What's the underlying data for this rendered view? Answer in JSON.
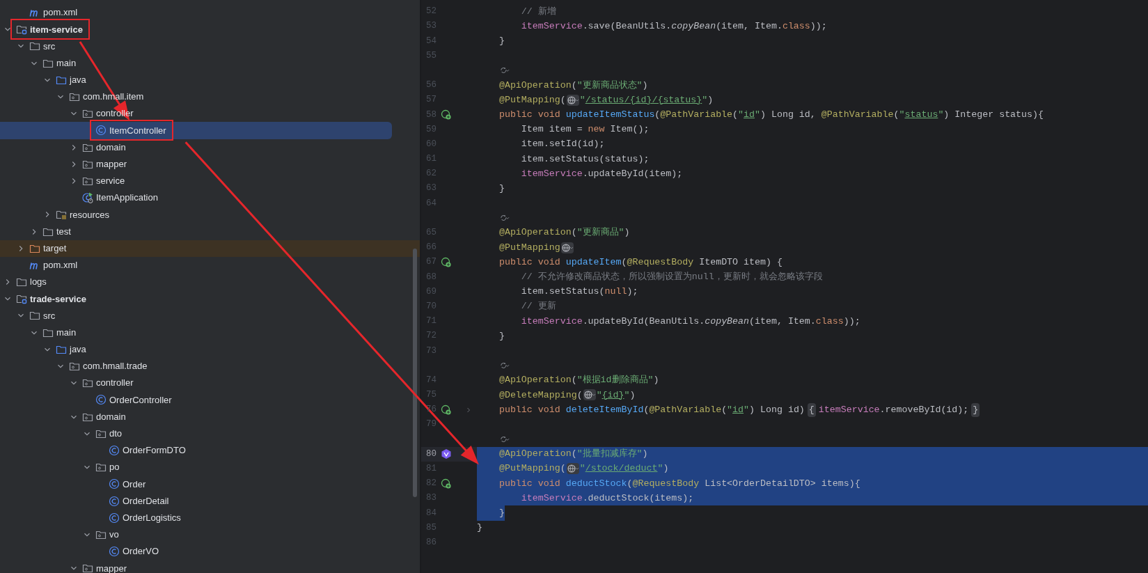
{
  "project_tree": {
    "continued_items": [
      {
        "label": "pom.xml",
        "kind": "maven",
        "selected": false,
        "framed": false,
        "excluded": false
      }
    ],
    "items": [
      {
        "label": "item-service",
        "kind": "module",
        "expanded": true,
        "selected": false,
        "framed": true,
        "excluded": false,
        "children": [
          {
            "label": "src",
            "kind": "folder",
            "expanded": true,
            "selected": false,
            "framed": false,
            "excluded": false,
            "children": [
              {
                "label": "main",
                "kind": "folder",
                "expanded": true,
                "selected": false,
                "framed": false,
                "excluded": false,
                "children": [
                  {
                    "label": "java",
                    "kind": "source",
                    "expanded": true,
                    "selected": false,
                    "framed": false,
                    "excluded": false,
                    "children": [
                      {
                        "label": "com.hmall.item",
                        "kind": "package",
                        "expanded": true,
                        "selected": false,
                        "framed": false,
                        "excluded": false,
                        "children": [
                          {
                            "label": "controller",
                            "kind": "package",
                            "expanded": true,
                            "selected": false,
                            "framed": false,
                            "excluded": false,
                            "children": [
                              {
                                "label": "ItemController",
                                "kind": "class",
                                "selected": true,
                                "framed": true,
                                "excluded": false
                              }
                            ]
                          },
                          {
                            "label": "domain",
                            "kind": "package",
                            "expanded": false,
                            "selected": false,
                            "framed": false,
                            "excluded": false
                          },
                          {
                            "label": "mapper",
                            "kind": "package",
                            "expanded": false,
                            "selected": false,
                            "framed": false,
                            "excluded": false
                          },
                          {
                            "label": "service",
                            "kind": "package",
                            "expanded": false,
                            "selected": false,
                            "framed": false,
                            "excluded": false
                          },
                          {
                            "label": "ItemApplication",
                            "kind": "app",
                            "selected": false,
                            "framed": false,
                            "excluded": false
                          }
                        ]
                      }
                    ]
                  },
                  {
                    "label": "resources",
                    "kind": "resources",
                    "expanded": false,
                    "selected": false,
                    "framed": false,
                    "excluded": false
                  }
                ]
              },
              {
                "label": "test",
                "kind": "folder",
                "expanded": false,
                "selected": false,
                "framed": false,
                "excluded": false
              }
            ]
          },
          {
            "label": "target",
            "kind": "folder",
            "expanded": false,
            "selected": false,
            "framed": false,
            "excluded": true
          },
          {
            "label": "pom.xml",
            "kind": "maven",
            "selected": false,
            "framed": false,
            "excluded": false
          }
        ]
      },
      {
        "label": "logs",
        "kind": "folder",
        "expanded": false,
        "selected": false,
        "framed": false,
        "excluded": false
      },
      {
        "label": "trade-service",
        "kind": "module",
        "expanded": true,
        "selected": false,
        "framed": false,
        "excluded": false,
        "children": [
          {
            "label": "src",
            "kind": "folder",
            "expanded": true,
            "selected": false,
            "framed": false,
            "excluded": false,
            "children": [
              {
                "label": "main",
                "kind": "folder",
                "expanded": true,
                "selected": false,
                "framed": false,
                "excluded": false,
                "children": [
                  {
                    "label": "java",
                    "kind": "source",
                    "expanded": true,
                    "selected": false,
                    "framed": false,
                    "excluded": false,
                    "children": [
                      {
                        "label": "com.hmall.trade",
                        "kind": "package",
                        "expanded": true,
                        "selected": false,
                        "framed": false,
                        "excluded": false,
                        "children": [
                          {
                            "label": "controller",
                            "kind": "package",
                            "expanded": true,
                            "selected": false,
                            "framed": false,
                            "excluded": false,
                            "children": [
                              {
                                "label": "OrderController",
                                "kind": "class",
                                "selected": false,
                                "framed": false,
                                "excluded": false
                              }
                            ]
                          },
                          {
                            "label": "domain",
                            "kind": "package",
                            "expanded": true,
                            "selected": false,
                            "framed": false,
                            "excluded": false,
                            "children": [
                              {
                                "label": "dto",
                                "kind": "package",
                                "expanded": true,
                                "selected": false,
                                "framed": false,
                                "excluded": false,
                                "children": [
                                  {
                                    "label": "OrderFormDTO",
                                    "kind": "class",
                                    "selected": false,
                                    "framed": false,
                                    "excluded": false
                                  }
                                ]
                              },
                              {
                                "label": "po",
                                "kind": "package",
                                "expanded": true,
                                "selected": false,
                                "framed": false,
                                "excluded": false,
                                "children": [
                                  {
                                    "label": "Order",
                                    "kind": "class",
                                    "selected": false,
                                    "framed": false,
                                    "excluded": false
                                  },
                                  {
                                    "label": "OrderDetail",
                                    "kind": "class",
                                    "selected": false,
                                    "framed": false,
                                    "excluded": false
                                  },
                                  {
                                    "label": "OrderLogistics",
                                    "kind": "class",
                                    "selected": false,
                                    "framed": false,
                                    "excluded": false
                                  }
                                ]
                              },
                              {
                                "label": "vo",
                                "kind": "package",
                                "expanded": true,
                                "selected": false,
                                "framed": false,
                                "excluded": false,
                                "children": [
                                  {
                                    "label": "OrderVO",
                                    "kind": "class",
                                    "selected": false,
                                    "framed": false,
                                    "excluded": false
                                  }
                                ]
                              }
                            ]
                          },
                          {
                            "label": "mapper",
                            "kind": "package",
                            "expanded": true,
                            "selected": false,
                            "framed": false,
                            "excluded": false
                          }
                        ]
                      }
                    ]
                  }
                ]
              }
            ]
          }
        ]
      }
    ]
  },
  "editor": {
    "lines": [
      {
        "kind": "code",
        "number": "52",
        "current": false,
        "selected": false,
        "segments": [
          {
            "kind": "comment",
            "text": "        // 新增"
          }
        ]
      },
      {
        "kind": "code",
        "number": "53",
        "current": false,
        "selected": false,
        "segments": [
          {
            "kind": "field",
            "text": "        itemService"
          },
          {
            "kind": "plain",
            "text": ".save(BeanUtils."
          },
          {
            "kind": "static",
            "text": "copyBean"
          },
          {
            "kind": "plain",
            "text": "(item, Item."
          },
          {
            "kind": "keyword",
            "text": "class"
          },
          {
            "kind": "plain",
            "text": "));"
          }
        ]
      },
      {
        "kind": "code",
        "number": "54",
        "current": false,
        "selected": false,
        "segments": [
          {
            "kind": "plain",
            "text": "    }"
          }
        ]
      },
      {
        "kind": "code",
        "number": "55",
        "current": false,
        "selected": false
      },
      {
        "kind": "hint"
      },
      {
        "kind": "code",
        "number": "56",
        "current": false,
        "selected": false,
        "segments": [
          {
            "kind": "annotation",
            "text": "    @ApiOperation"
          },
          {
            "kind": "plain",
            "text": "("
          },
          {
            "kind": "string",
            "text": "\"更新商品状态\""
          },
          {
            "kind": "plain",
            "text": ")"
          }
        ]
      },
      {
        "kind": "code",
        "number": "57",
        "current": false,
        "selected": false,
        "segments": [
          {
            "kind": "annotation",
            "text": "    @PutMapping"
          },
          {
            "kind": "plain",
            "text": "("
          },
          {
            "kind": "globe"
          },
          {
            "kind": "string",
            "text": "\""
          },
          {
            "kind": "link",
            "text": "/status/{id}/{status}"
          },
          {
            "kind": "string",
            "text": "\""
          },
          {
            "kind": "plain",
            "text": ")"
          }
        ]
      },
      {
        "kind": "code",
        "number": "58",
        "current": false,
        "selected": false,
        "gutter_icon": {
          "kind": "endpoint"
        },
        "segments": [
          {
            "kind": "keyword",
            "text": "    public void "
          },
          {
            "kind": "method",
            "text": "updateItemStatus"
          },
          {
            "kind": "plain",
            "text": "("
          },
          {
            "kind": "annotation",
            "text": "@PathVariable"
          },
          {
            "kind": "plain",
            "text": "("
          },
          {
            "kind": "string",
            "text": "\""
          },
          {
            "kind": "link",
            "text": "id"
          },
          {
            "kind": "string",
            "text": "\""
          },
          {
            "kind": "plain",
            "text": ") Long id, "
          },
          {
            "kind": "annotation",
            "text": "@PathVariable"
          },
          {
            "kind": "plain",
            "text": "("
          },
          {
            "kind": "string",
            "text": "\""
          },
          {
            "kind": "link",
            "text": "status"
          },
          {
            "kind": "string",
            "text": "\""
          },
          {
            "kind": "plain",
            "text": ") Integer status){"
          }
        ]
      },
      {
        "kind": "code",
        "number": "59",
        "current": false,
        "selected": false,
        "segments": [
          {
            "kind": "plain",
            "text": "        Item item = "
          },
          {
            "kind": "keyword",
            "text": "new"
          },
          {
            "kind": "plain",
            "text": " Item();"
          }
        ]
      },
      {
        "kind": "code",
        "number": "60",
        "current": false,
        "selected": false,
        "segments": [
          {
            "kind": "plain",
            "text": "        item.setId(id);"
          }
        ]
      },
      {
        "kind": "code",
        "number": "61",
        "current": false,
        "selected": false,
        "segments": [
          {
            "kind": "plain",
            "text": "        item.setStatus(status);"
          }
        ]
      },
      {
        "kind": "code",
        "number": "62",
        "current": false,
        "selected": false,
        "segments": [
          {
            "kind": "field",
            "text": "        itemService"
          },
          {
            "kind": "plain",
            "text": ".updateById(item);"
          }
        ]
      },
      {
        "kind": "code",
        "number": "63",
        "current": false,
        "selected": false,
        "segments": [
          {
            "kind": "plain",
            "text": "    }"
          }
        ]
      },
      {
        "kind": "code",
        "number": "64",
        "current": false,
        "selected": false
      },
      {
        "kind": "hint"
      },
      {
        "kind": "code",
        "number": "65",
        "current": false,
        "selected": false,
        "segments": [
          {
            "kind": "annotation",
            "text": "    @ApiOperation"
          },
          {
            "kind": "plain",
            "text": "("
          },
          {
            "kind": "string",
            "text": "\"更新商品\""
          },
          {
            "kind": "plain",
            "text": ")"
          }
        ]
      },
      {
        "kind": "code",
        "number": "66",
        "current": false,
        "selected": false,
        "segments": [
          {
            "kind": "annotation",
            "text": "    @PutMapping"
          },
          {
            "kind": "globe"
          }
        ]
      },
      {
        "kind": "code",
        "number": "67",
        "current": false,
        "selected": false,
        "gutter_icon": {
          "kind": "endpoint"
        },
        "segments": [
          {
            "kind": "keyword",
            "text": "    public void "
          },
          {
            "kind": "method",
            "text": "updateItem"
          },
          {
            "kind": "plain",
            "text": "("
          },
          {
            "kind": "annotation",
            "text": "@RequestBody"
          },
          {
            "kind": "plain",
            "text": " ItemDTO item) {"
          }
        ]
      },
      {
        "kind": "code",
        "number": "68",
        "current": false,
        "selected": false,
        "segments": [
          {
            "kind": "comment",
            "text": "        // 不允许修改商品状态，所以强制设置为null，更新时，就会忽略该字段"
          }
        ]
      },
      {
        "kind": "code",
        "number": "69",
        "current": false,
        "selected": false,
        "segments": [
          {
            "kind": "plain",
            "text": "        item.setStatus("
          },
          {
            "kind": "keyword",
            "text": "null"
          },
          {
            "kind": "plain",
            "text": ");"
          }
        ]
      },
      {
        "kind": "code",
        "number": "70",
        "current": false,
        "selected": false,
        "segments": [
          {
            "kind": "comment",
            "text": "        // 更新"
          }
        ]
      },
      {
        "kind": "code",
        "number": "71",
        "current": false,
        "selected": false,
        "segments": [
          {
            "kind": "field",
            "text": "        itemService"
          },
          {
            "kind": "plain",
            "text": ".updateById(BeanUtils."
          },
          {
            "kind": "static",
            "text": "copyBean"
          },
          {
            "kind": "plain",
            "text": "(item, Item."
          },
          {
            "kind": "keyword",
            "text": "class"
          },
          {
            "kind": "plain",
            "text": "));"
          }
        ]
      },
      {
        "kind": "code",
        "number": "72",
        "current": false,
        "selected": false,
        "segments": [
          {
            "kind": "plain",
            "text": "    }"
          }
        ]
      },
      {
        "kind": "code",
        "number": "73",
        "current": false,
        "selected": false
      },
      {
        "kind": "hint"
      },
      {
        "kind": "code",
        "number": "74",
        "current": false,
        "selected": false,
        "segments": [
          {
            "kind": "annotation",
            "text": "    @ApiOperation"
          },
          {
            "kind": "plain",
            "text": "("
          },
          {
            "kind": "string",
            "text": "\"根据id删除商品\""
          },
          {
            "kind": "plain",
            "text": ")"
          }
        ]
      },
      {
        "kind": "code",
        "number": "75",
        "current": false,
        "selected": false,
        "segments": [
          {
            "kind": "annotation",
            "text": "    @DeleteMapping"
          },
          {
            "kind": "plain",
            "text": "("
          },
          {
            "kind": "globe"
          },
          {
            "kind": "string",
            "text": "\""
          },
          {
            "kind": "link",
            "text": "{id}"
          },
          {
            "kind": "string",
            "text": "\""
          },
          {
            "kind": "plain",
            "text": ")"
          }
        ]
      },
      {
        "kind": "code",
        "number": "76",
        "current": false,
        "selected": false,
        "gutter_icon": {
          "kind": "endpoint"
        },
        "segments": [
          {
            "kind": "keyword",
            "text": "    public void "
          },
          {
            "kind": "method",
            "text": "deleteItemById"
          },
          {
            "kind": "plain",
            "text": "("
          },
          {
            "kind": "annotation",
            "text": "@PathVariable"
          },
          {
            "kind": "plain",
            "text": "("
          },
          {
            "kind": "string",
            "text": "\""
          },
          {
            "kind": "link",
            "text": "id"
          },
          {
            "kind": "string",
            "text": "\""
          },
          {
            "kind": "plain",
            "text": ") Long id)"
          },
          {
            "kind": "fold",
            "text": "{"
          },
          {
            "kind": "field",
            "text": "itemService"
          },
          {
            "kind": "plain",
            "text": ".removeById(id);"
          },
          {
            "kind": "fold",
            "text": "}"
          }
        ]
      },
      {
        "kind": "code",
        "number": "79",
        "current": false,
        "selected": false
      },
      {
        "kind": "hint"
      },
      {
        "kind": "code",
        "number": "80",
        "current": true,
        "selected": true,
        "gutter_icon": {
          "kind": "implements"
        },
        "segments": [
          {
            "kind": "annotation",
            "text": "    @ApiOperation"
          },
          {
            "kind": "plain",
            "text": "("
          },
          {
            "kind": "string",
            "text": "\"批量扣减库存\""
          },
          {
            "kind": "plain",
            "text": ")"
          }
        ]
      },
      {
        "kind": "code",
        "number": "81",
        "current": false,
        "selected": true,
        "segments": [
          {
            "kind": "annotation",
            "text": "    @PutMapping"
          },
          {
            "kind": "plain",
            "text": "("
          },
          {
            "kind": "globe"
          },
          {
            "kind": "string",
            "text": "\""
          },
          {
            "kind": "link",
            "text": "/stock/deduct"
          },
          {
            "kind": "string",
            "text": "\""
          },
          {
            "kind": "plain",
            "text": ")"
          }
        ]
      },
      {
        "kind": "code",
        "number": "82",
        "current": false,
        "selected": true,
        "gutter_icon": {
          "kind": "endpoint"
        },
        "segments": [
          {
            "kind": "keyword",
            "text": "    public void "
          },
          {
            "kind": "method",
            "text": "deductStock"
          },
          {
            "kind": "plain",
            "text": "("
          },
          {
            "kind": "annotation",
            "text": "@RequestBody"
          },
          {
            "kind": "plain",
            "text": " List<OrderDetailDTO> items){"
          }
        ]
      },
      {
        "kind": "code",
        "number": "83",
        "current": false,
        "selected": true,
        "segments": [
          {
            "kind": "field",
            "text": "        itemService"
          },
          {
            "kind": "plain",
            "text": ".deductStock(items);"
          }
        ]
      },
      {
        "kind": "code",
        "number": "84",
        "current": false,
        "selected": true,
        "segments": [
          {
            "kind": "plain",
            "text": "    }"
          }
        ]
      },
      {
        "kind": "code",
        "number": "85",
        "current": false,
        "selected": false,
        "segments": [
          {
            "kind": "plain",
            "text": "}"
          }
        ]
      },
      {
        "kind": "code",
        "number": "86",
        "current": false,
        "selected": false
      }
    ]
  },
  "arrows": [
    {
      "kind": "frame-to-frame"
    },
    {
      "kind": "frame-to-line"
    }
  ]
}
